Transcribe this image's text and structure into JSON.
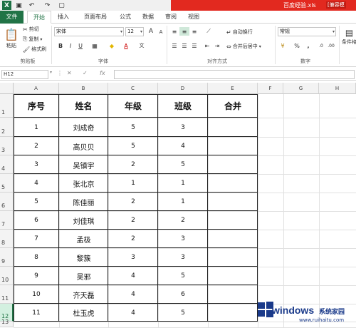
{
  "window": {
    "title": "百度经验.xls",
    "user": "[兼容模"
  },
  "tabs": [
    "文件",
    "开始",
    "插入",
    "页面布局",
    "公式",
    "数据",
    "审阅",
    "视图"
  ],
  "ribbon": {
    "clipboard": {
      "paste": "粘贴",
      "cut": "剪切",
      "copy": "复制",
      "painter": "格式刷",
      "label": "剪贴板"
    },
    "font": {
      "name": "宋体",
      "size": "12",
      "bold": "B",
      "italic": "I",
      "underline": "U",
      "grow": "A",
      "shrink": "A",
      "label": "字体"
    },
    "align": {
      "wrap": "自动换行",
      "merge": "合并后居中",
      "label": "对齐方式"
    },
    "number": {
      "format": "常规",
      "percent": "%",
      "comma": ",",
      "label": "数字"
    },
    "styles": {
      "cond": "条件格"
    }
  },
  "formula_bar": {
    "name_box": "H12",
    "fx": "fx",
    "value": ""
  },
  "columns": [
    "A",
    "B",
    "C",
    "D",
    "E",
    "F",
    "G",
    "H"
  ],
  "rows": [
    "1",
    "2",
    "3",
    "4",
    "5",
    "6",
    "7",
    "8",
    "9",
    "10",
    "11",
    "12",
    "13"
  ],
  "table": {
    "headers": [
      "序号",
      "姓名",
      "年级",
      "班级",
      "合并"
    ],
    "data": [
      [
        "1",
        "刘成奇",
        "5",
        "3",
        ""
      ],
      [
        "2",
        "高贝贝",
        "5",
        "4",
        ""
      ],
      [
        "3",
        "吴镇宇",
        "2",
        "5",
        ""
      ],
      [
        "4",
        "张北京",
        "1",
        "1",
        ""
      ],
      [
        "5",
        "陈佳丽",
        "2",
        "1",
        ""
      ],
      [
        "6",
        "刘佳琪",
        "2",
        "2",
        ""
      ],
      [
        "7",
        "孟极",
        "2",
        "3",
        ""
      ],
      [
        "8",
        "黎簇",
        "3",
        "3",
        ""
      ],
      [
        "9",
        "吴邪",
        "4",
        "5",
        ""
      ],
      [
        "10",
        "齐天磊",
        "4",
        "6",
        ""
      ],
      [
        "11",
        "杜玉虎",
        "4",
        "5",
        ""
      ]
    ]
  },
  "watermark": {
    "brand": "windows",
    "sub": "系统家园",
    "url": "www.ruihaitu.com"
  }
}
